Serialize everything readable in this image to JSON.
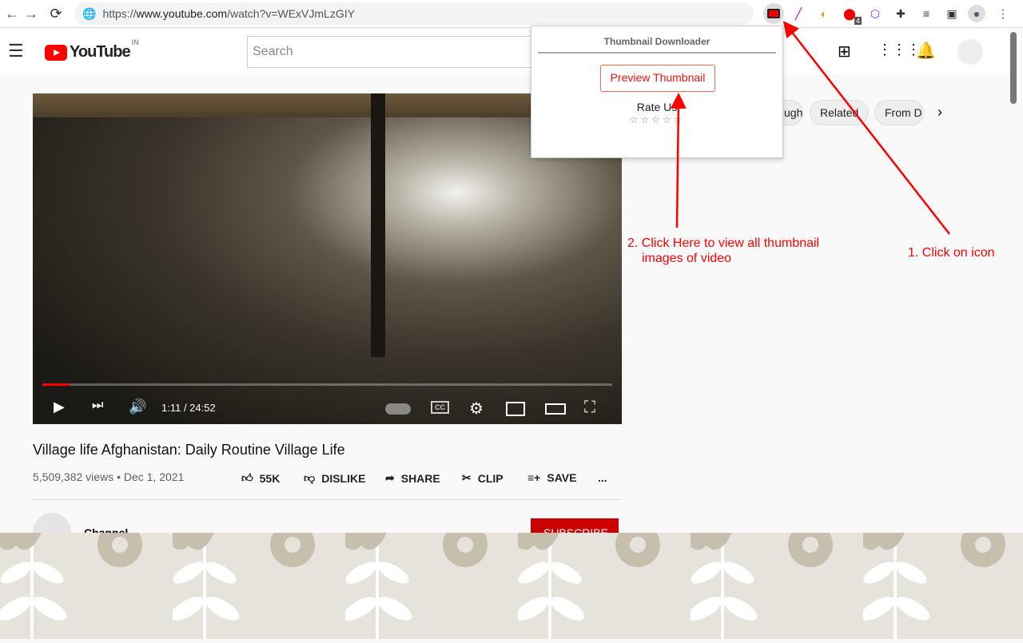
{
  "browser": {
    "url_prefix": "https://",
    "url_domain": "www.youtube.com",
    "url_path": "/watch?v=WExVJmLzGIY",
    "ext_badge": "4"
  },
  "youtube": {
    "logo_text": "YouTube",
    "region": "IN",
    "search_placeholder": "Search",
    "chips": [
      "ugh",
      "Related",
      "From D"
    ],
    "video": {
      "time": "1:11 / 24:52",
      "progress_percent": 4.8,
      "title": "Village life Afghanistan: Daily Routine Village Life",
      "views": "5,509,382 views • Dec 1, 2021"
    },
    "actions": {
      "like": "55K",
      "dislike": "DISLIKE",
      "share": "SHARE",
      "clip": "CLIP",
      "save": "SAVE",
      "more": "..."
    },
    "channel": "Channel",
    "subscribe": "SUBSCRIBE"
  },
  "popup": {
    "title": "Thumbnail Downloader",
    "button": "Preview Thumbnail",
    "rate_label": "Rate Us",
    "stars": "☆☆☆☆☆"
  },
  "annotations": {
    "step1": "1. Click on icon",
    "step2_line1": "2. Click Here to view all thumbnail",
    "step2_line2": "images of video"
  },
  "colors": {
    "accent": "#ff0000",
    "popup_button": "#e8150c"
  }
}
